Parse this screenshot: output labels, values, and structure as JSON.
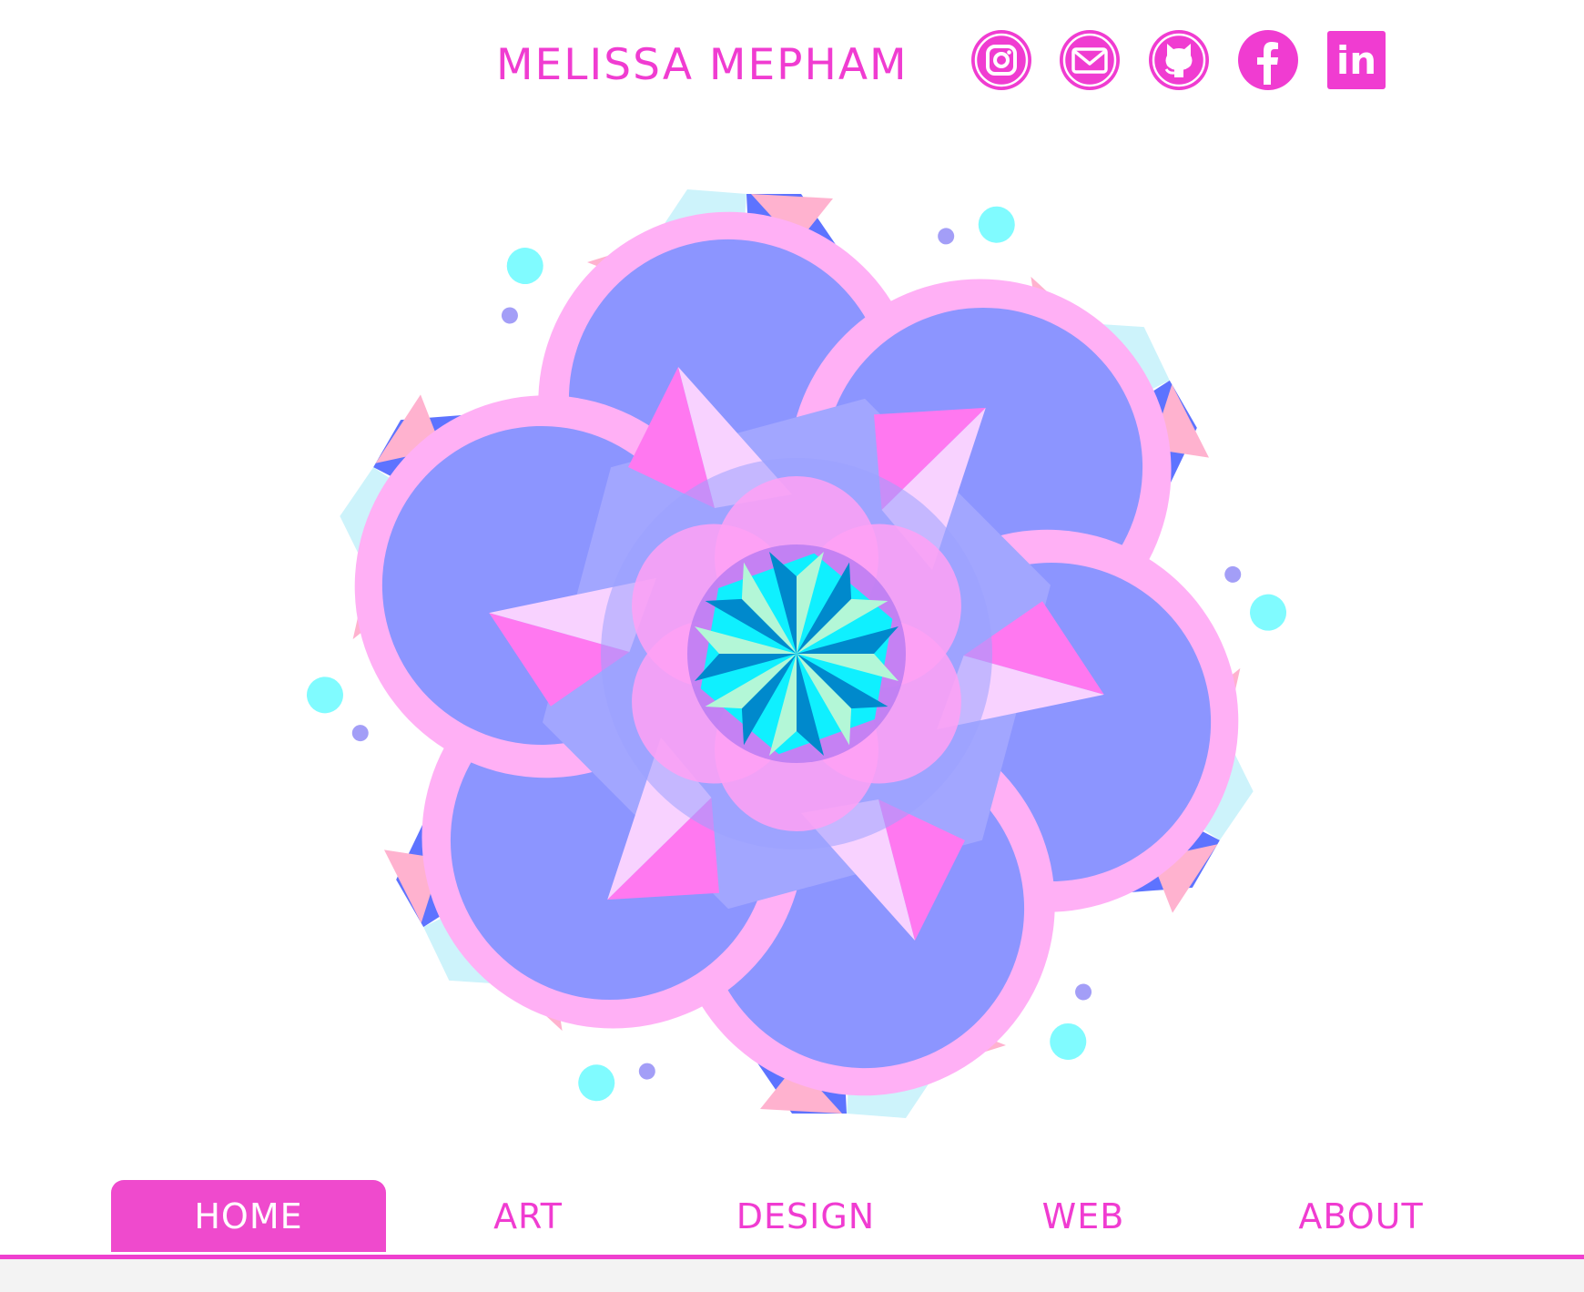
{
  "site": {
    "title": "MELISSA MEPHAM",
    "accent_color": "#f03cd1"
  },
  "social": [
    {
      "name": "instagram-icon",
      "label": "Instagram"
    },
    {
      "name": "email-icon",
      "label": "Email"
    },
    {
      "name": "github-icon",
      "label": "GitHub"
    },
    {
      "name": "facebook-icon",
      "label": "Facebook"
    },
    {
      "name": "linkedin-icon",
      "label": "LinkedIn",
      "glyph": "in"
    }
  ],
  "hero": {
    "type": "geometric mandala illustration",
    "colors": {
      "periwinkle": "#8c95ff",
      "blue": "#5d73ff",
      "light_cyan": "#cdf3fb",
      "pink": "#ffb0da",
      "magenta": "#ff78f0",
      "rose": "#ffb2cf",
      "cyan": "#0ff0ff",
      "aqua": "#80fbff"
    }
  },
  "nav": {
    "items": [
      {
        "label": "HOME",
        "active": true
      },
      {
        "label": "ART",
        "active": false
      },
      {
        "label": "DESIGN",
        "active": false
      },
      {
        "label": "WEB",
        "active": false
      },
      {
        "label": "ABOUT",
        "active": false
      }
    ]
  }
}
